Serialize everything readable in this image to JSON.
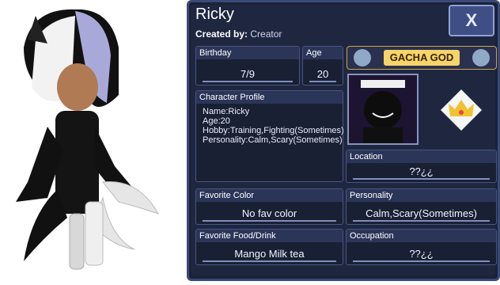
{
  "character": {
    "name": "Ricky",
    "created_by_label": "Created by:",
    "created_by": "Creator"
  },
  "close": {
    "label": "X"
  },
  "badge": {
    "label": "GACHA GOD"
  },
  "birthday": {
    "label": "Birthday",
    "value": "7/9"
  },
  "age": {
    "label": "Age",
    "value": "20"
  },
  "profile": {
    "label": "Character Profile",
    "text": "Name:Ricky\nAge:20\nHobby:Training,Fighting(Sometimes)\nPersonality:Calm,Scary(Sometimes)"
  },
  "location": {
    "label": "Location",
    "value": "??¿¿"
  },
  "favorite_color": {
    "label": "Favorite Color",
    "value": "No fav color"
  },
  "personality": {
    "label": "Personality",
    "value": "Calm,Scary(Sometimes)"
  },
  "favorite_food": {
    "label": "Favorite Food/Drink",
    "value": "Mango Milk tea"
  },
  "occupation": {
    "label": "Occupation",
    "value": "??¿¿"
  }
}
